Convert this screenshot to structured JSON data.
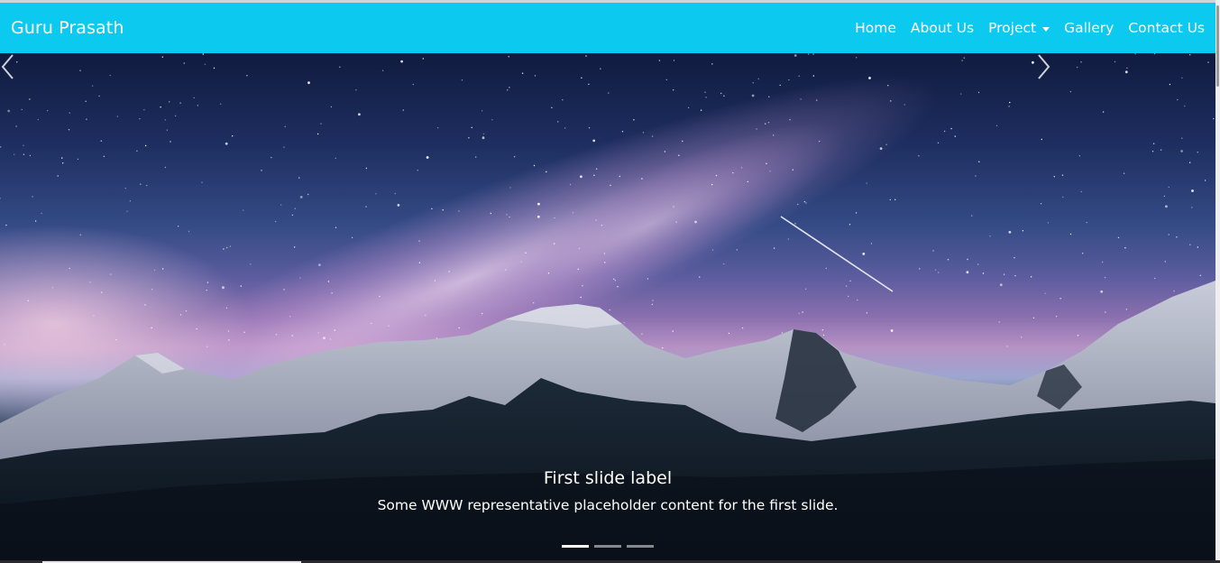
{
  "brand": {
    "name": "Guru Prasath"
  },
  "nav": {
    "items": [
      {
        "label": "Home"
      },
      {
        "label": "About Us"
      },
      {
        "label": "Project"
      },
      {
        "label": "Gallery"
      },
      {
        "label": "Contact Us"
      }
    ],
    "dropdown_icon": "caret-down-icon"
  },
  "carousel": {
    "active_slide": 1,
    "slide_count": 3,
    "caption": {
      "title": "First slide label",
      "text": "Some WWW representative placeholder content for the first slide."
    },
    "prev_icon": "chevron-left-icon",
    "next_icon": "chevron-right-icon"
  },
  "colors": {
    "navbar": "#0cc9f0",
    "nav_text": "#ffffff"
  }
}
